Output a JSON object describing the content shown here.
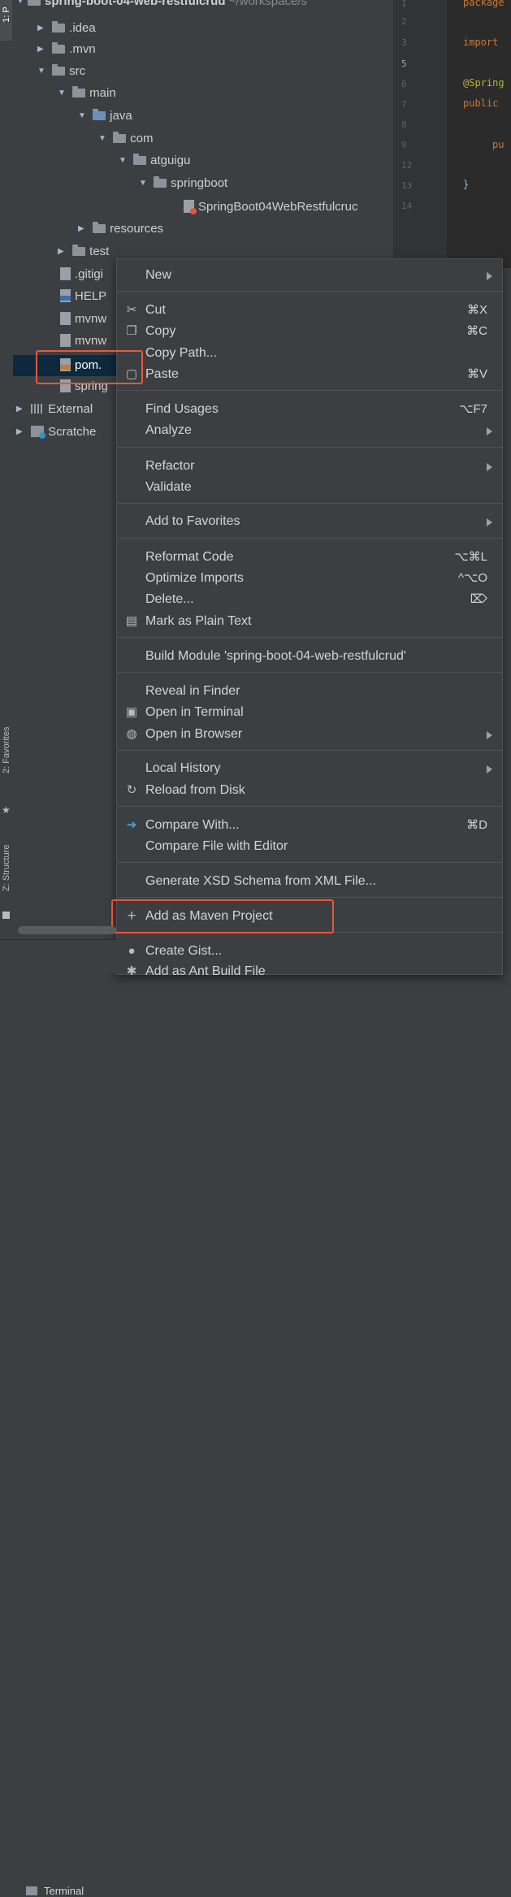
{
  "side_stripe": {
    "project_label": "1: P",
    "favorites_label": "2: Favorites",
    "structure_label": "Z: Structure"
  },
  "tree": {
    "root_label": "spring-boot-04-web-restfulcrud",
    "root_path": "~/workspace/s",
    "items": [
      {
        "label": ".idea"
      },
      {
        "label": ".mvn"
      },
      {
        "label": "src"
      },
      {
        "label": "main"
      },
      {
        "label": "java"
      },
      {
        "label": "com"
      },
      {
        "label": "atguigu"
      },
      {
        "label": "springboot"
      },
      {
        "label": "SpringBoot04WebRestfulcruc"
      },
      {
        "label": "resources"
      },
      {
        "label": "test"
      },
      {
        "label": ".gitigi"
      },
      {
        "label": "HELP"
      },
      {
        "label": "mvnw"
      },
      {
        "label": "mvnw"
      },
      {
        "label": "pom."
      },
      {
        "label": "spring"
      },
      {
        "label": "External"
      },
      {
        "label": "Scratche"
      }
    ]
  },
  "editor": {
    "line_numbers": [
      "1",
      "2",
      "3",
      "5",
      "6",
      "7",
      "8",
      "9",
      "12",
      "13",
      "14"
    ],
    "code": {
      "package": "package",
      "import": "import",
      "annotation": "@Spring",
      "public": "public",
      "pu": "pu",
      "brace": "}"
    }
  },
  "context_menu": {
    "items": [
      {
        "label": "New",
        "shortcut": "",
        "submenu": true,
        "icon": ""
      },
      {
        "label": "Cut",
        "shortcut": "⌘X",
        "icon": "scissors-icon"
      },
      {
        "label": "Copy",
        "shortcut": "⌘C",
        "icon": "copy-icon"
      },
      {
        "label": "Copy Path...",
        "shortcut": "",
        "icon": ""
      },
      {
        "label": "Paste",
        "shortcut": "⌘V",
        "icon": "paste-icon"
      },
      {
        "label": "Find Usages",
        "shortcut": "⌥F7",
        "icon": ""
      },
      {
        "label": "Analyze",
        "shortcut": "",
        "submenu": true,
        "icon": ""
      },
      {
        "label": "Refactor",
        "shortcut": "",
        "submenu": true,
        "icon": ""
      },
      {
        "label": "Validate",
        "shortcut": "",
        "icon": ""
      },
      {
        "label": "Add to Favorites",
        "shortcut": "",
        "submenu": true,
        "icon": ""
      },
      {
        "label": "Reformat Code",
        "shortcut": "⌥⌘L",
        "icon": ""
      },
      {
        "label": "Optimize Imports",
        "shortcut": "^⌥O",
        "icon": ""
      },
      {
        "label": "Delete...",
        "shortcut": "⌦",
        "icon": ""
      },
      {
        "label": "Mark as Plain Text",
        "shortcut": "",
        "icon": "plain-text-icon"
      },
      {
        "label": "Build Module 'spring-boot-04-web-restfulcrud'",
        "shortcut": "",
        "icon": ""
      },
      {
        "label": "Reveal in Finder",
        "shortcut": "",
        "icon": ""
      },
      {
        "label": "Open in Terminal",
        "shortcut": "",
        "icon": "terminal-icon"
      },
      {
        "label": "Open in Browser",
        "shortcut": "",
        "submenu": true,
        "icon": "globe-icon"
      },
      {
        "label": "Local History",
        "shortcut": "",
        "submenu": true,
        "icon": ""
      },
      {
        "label": "Reload from Disk",
        "shortcut": "",
        "icon": "reload-icon"
      },
      {
        "label": "Compare With...",
        "shortcut": "⌘D",
        "icon": "compare-icon"
      },
      {
        "label": "Compare File with Editor",
        "shortcut": "",
        "icon": ""
      },
      {
        "label": "Generate XSD Schema from XML File...",
        "shortcut": "",
        "icon": ""
      },
      {
        "label": "Add as Maven Project",
        "shortcut": "",
        "icon": "plus-icon"
      },
      {
        "label": "Create Gist...",
        "shortcut": "",
        "icon": "github-icon"
      },
      {
        "label": "Add as Ant Build File",
        "shortcut": "",
        "icon": "ant-icon"
      }
    ]
  },
  "bottom_bar": {
    "terminal_label": "Terminal"
  },
  "colors": {
    "highlight_border": "#e8573a",
    "selection": "#0d293e",
    "menu_bg": "#3c3f41"
  }
}
